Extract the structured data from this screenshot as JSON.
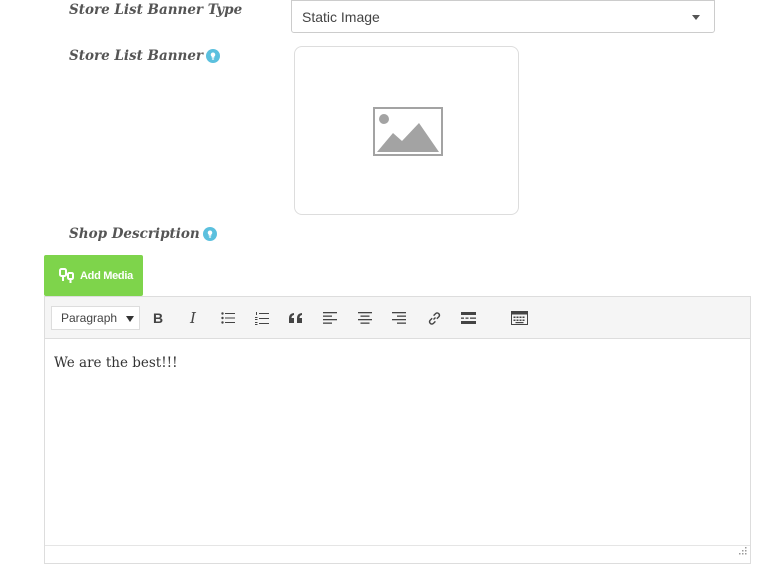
{
  "fields": {
    "banner_type_label": "Store List Banner Type",
    "banner_label": "Store List Banner",
    "description_label": "Shop Description"
  },
  "banner_type_select": {
    "value": "Static Image"
  },
  "add_media": {
    "label": "Add Media",
    "color": "#7ed44b"
  },
  "editor": {
    "format_value": "Paragraph",
    "toolbar_icons": [
      "bold-icon",
      "italic-icon",
      "bulleted-list-icon",
      "numbered-list-icon",
      "blockquote-icon",
      "align-left-icon",
      "align-center-icon",
      "align-right-icon",
      "link-icon",
      "read-more-icon",
      "toolbar-toggle-icon"
    ],
    "bold_glyph": "B",
    "italic_glyph": "I",
    "content": "We are the best!!!"
  },
  "colors": {
    "help_icon": "#5bc0de",
    "label_text": "#555555"
  }
}
